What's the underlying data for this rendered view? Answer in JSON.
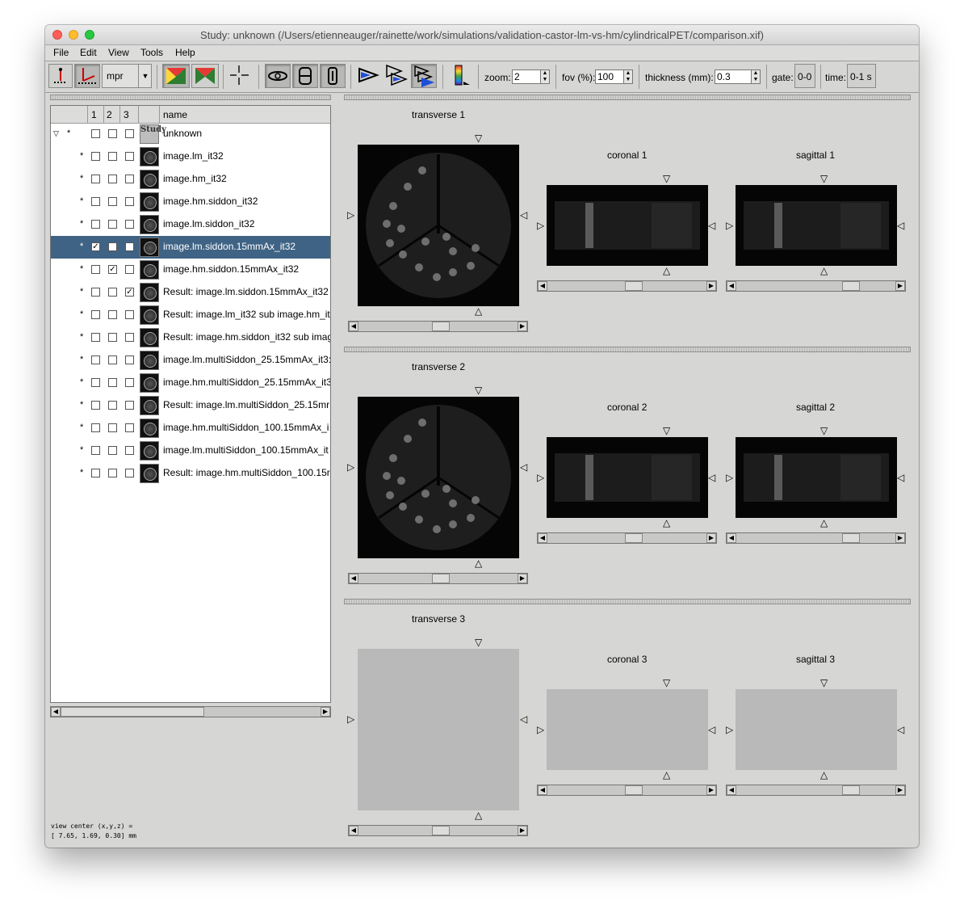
{
  "window": {
    "title": "Study: unknown (/Users/etienneauger/rainette/work/simulations/validation-castor-lm-vs-hm/cylindricalPET/comparison.xif)"
  },
  "menu": [
    "File",
    "Edit",
    "View",
    "Tools",
    "Help"
  ],
  "toolbar": {
    "layout_select": "mpr",
    "zoom_label": "zoom:",
    "zoom_value": "2",
    "fov_label": "fov (%):",
    "fov_value": "100",
    "thickness_label": "thickness (mm):",
    "thickness_value": "0.3",
    "gate_label": "gate:",
    "gate_value": "0-0",
    "time_label": "time:",
    "time_value": "0-1 s"
  },
  "tree": {
    "headers": [
      "1",
      "2",
      "3",
      "name"
    ],
    "rows": [
      {
        "label": "unknown",
        "star": "*",
        "study": true,
        "c1": false,
        "c2": false,
        "c3": false
      },
      {
        "label": "image.lm_it32",
        "star": "*",
        "c1": false,
        "c2": false,
        "c3": false
      },
      {
        "label": "image.hm_it32",
        "star": "*",
        "c1": false,
        "c2": false,
        "c3": false
      },
      {
        "label": "image.hm.siddon_it32",
        "star": "*",
        "c1": false,
        "c2": false,
        "c3": false
      },
      {
        "label": "image.lm.siddon_it32",
        "star": "*",
        "c1": false,
        "c2": false,
        "c3": false
      },
      {
        "label": "image.lm.siddon.15mmAx_it32",
        "star": "*",
        "selected": true,
        "c1": true,
        "c2": false,
        "c3": false
      },
      {
        "label": "image.hm.siddon.15mmAx_it32",
        "star": "*",
        "c1": false,
        "c2": true,
        "c3": false
      },
      {
        "label": "Result: image.lm.siddon.15mmAx_it32",
        "star": "*",
        "c1": false,
        "c2": false,
        "c3": true
      },
      {
        "label": "Result: image.lm_it32 sub image.hm_it",
        "star": "*",
        "c1": false,
        "c2": false,
        "c3": false
      },
      {
        "label": "Result: image.hm.siddon_it32 sub imag",
        "star": "*",
        "c1": false,
        "c2": false,
        "c3": false
      },
      {
        "label": "image.lm.multiSiddon_25.15mmAx_it3:",
        "star": "*",
        "c1": false,
        "c2": false,
        "c3": false
      },
      {
        "label": "image.hm.multiSiddon_25.15mmAx_it3",
        "star": "*",
        "c1": false,
        "c2": false,
        "c3": false
      },
      {
        "label": "Result: image.lm.multiSiddon_25.15mr",
        "star": "*",
        "c1": false,
        "c2": false,
        "c3": false
      },
      {
        "label": "image.hm.multiSiddon_100.15mmAx_i",
        "star": "*",
        "c1": false,
        "c2": false,
        "c3": false
      },
      {
        "label": "image.lm.multiSiddon_100.15mmAx_it",
        "star": "*",
        "c1": false,
        "c2": false,
        "c3": false
      },
      {
        "label": "Result: image.hm.multiSiddon_100.15r",
        "star": "*",
        "c1": false,
        "c2": false,
        "c3": false
      }
    ]
  },
  "status": {
    "line1": "view center (x,y,z) =",
    "line2": "[ 7.65, 1.69, 0.30] mm"
  },
  "views": [
    {
      "transverse": "transverse 1",
      "coronal": "coronal 1",
      "sagittal": "sagittal 1"
    },
    {
      "transverse": "transverse 2",
      "coronal": "coronal 2",
      "sagittal": "sagittal 2"
    },
    {
      "transverse": "transverse 3",
      "coronal": "coronal 3",
      "sagittal": "sagittal 3"
    }
  ],
  "icons": {
    "close": "#fc5f57",
    "minimize": "#fdbc2e",
    "zoom": "#28c840",
    "selection": "#3f6384"
  }
}
